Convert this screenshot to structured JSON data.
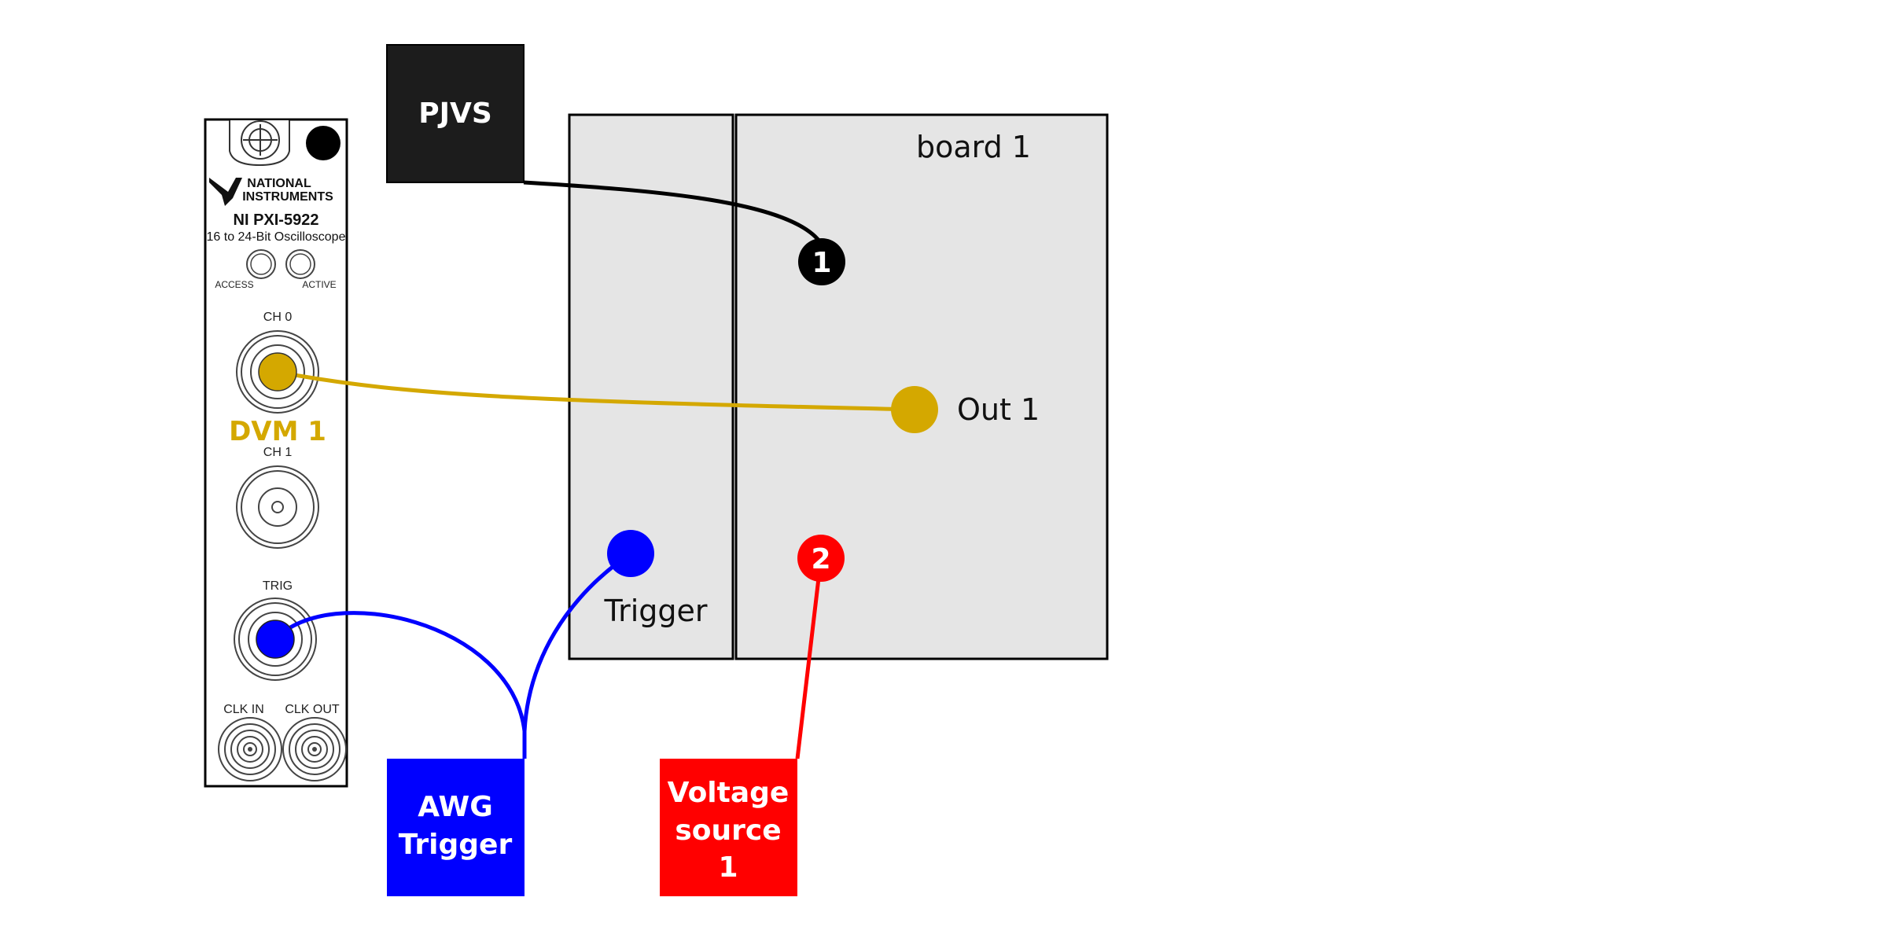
{
  "colors": {
    "pjvs": "#1c1c1c",
    "dvm": "#d4a800",
    "awg": "#0000ff",
    "voltage": "#ff0000",
    "board_fill": "#e5e5e5",
    "board_stroke": "#000000"
  },
  "instrument": {
    "brand_line1": "NATIONAL",
    "brand_line2": "INSTRUMENTS",
    "model": "NI PXI-5922",
    "description": "16 to 24-Bit Oscilloscope",
    "led_access": "ACCESS",
    "led_active": "ACTIVE",
    "ch0": "CH 0",
    "ch1": "CH 1",
    "trig": "TRIG",
    "clk_in": "CLK IN",
    "clk_out": "CLK OUT",
    "dvm_label": "DVM 1",
    "logo_icon": "ni-eagle-logo",
    "screw_icon": "thumbscrew-icon"
  },
  "board": {
    "label": "board 1",
    "out_label": "Out 1",
    "trigger_label": "Trigger",
    "port1_label": "1",
    "port2_label": "2"
  },
  "sources": {
    "pjvs": "PJVS",
    "awg_line1": "AWG",
    "awg_line2": "Trigger",
    "voltage_line1": "Voltage",
    "voltage_line2": "source",
    "voltage_line3": "1"
  }
}
